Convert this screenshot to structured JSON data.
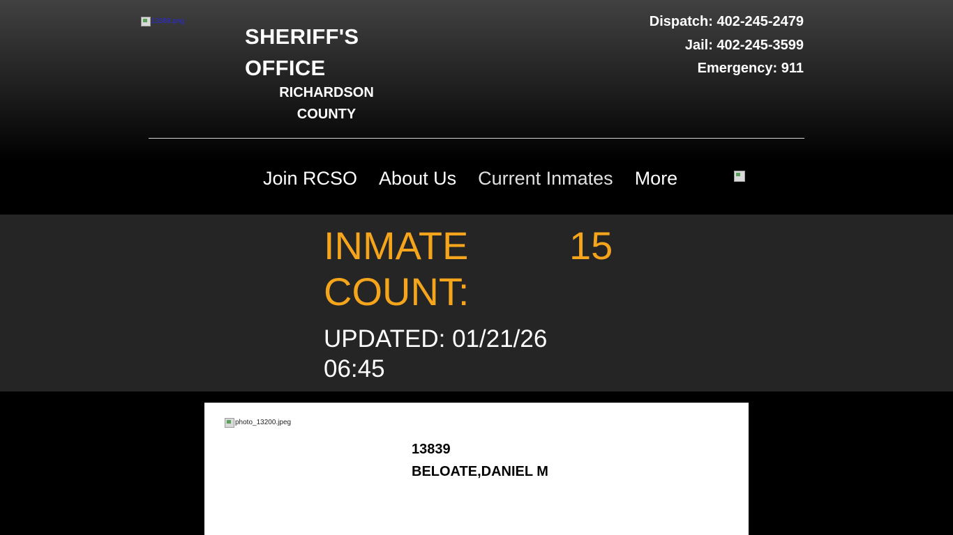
{
  "header": {
    "logo_alt": "13389.png",
    "title_line1": "SHERIFF'S",
    "title_line2": "OFFICE",
    "subtitle": "RICHARDSON COUNTY",
    "dispatch": "Dispatch: 402-245-2479",
    "jail": "Jail: 402-245-3599",
    "emergency": "Emergency: 911"
  },
  "nav": {
    "items": [
      {
        "label": "Join RCSO"
      },
      {
        "label": "About Us"
      },
      {
        "label": "Current Inmates"
      },
      {
        "label": "More"
      }
    ]
  },
  "inmate_count": {
    "label": "INMATE COUNT:",
    "value": "15",
    "updated": "UPDATED: 01/21/26 06:45"
  },
  "inmates": [
    {
      "photo_alt": "photo_13200.jpeg",
      "booking_number": "13839",
      "name": "BELOATE,DANIEL M"
    }
  ],
  "colors": {
    "accent": "#f4a51c",
    "band": "#252525",
    "background": "#000000"
  }
}
